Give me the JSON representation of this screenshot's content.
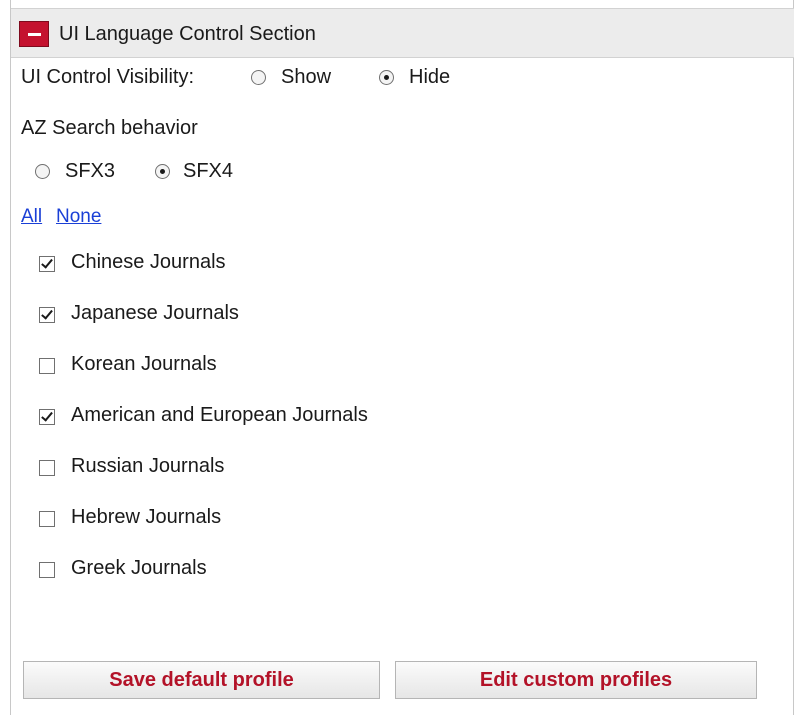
{
  "section": {
    "title": "UI Language Control Section",
    "collapse_icon": "minus-icon"
  },
  "visibility": {
    "label": "UI Control Visibility:",
    "options": [
      {
        "label": "Show",
        "checked": false
      },
      {
        "label": "Hide",
        "checked": true
      }
    ]
  },
  "az_search": {
    "label": "AZ Search behavior",
    "options": [
      {
        "label": "SFX3",
        "checked": false
      },
      {
        "label": "SFX4",
        "checked": true
      }
    ]
  },
  "select_links": {
    "all": "All",
    "none": "None"
  },
  "journals": [
    {
      "label": "Chinese Journals",
      "checked": true
    },
    {
      "label": "Japanese Journals",
      "checked": true
    },
    {
      "label": "Korean Journals",
      "checked": false
    },
    {
      "label": "American and European Journals",
      "checked": true
    },
    {
      "label": "Russian Journals",
      "checked": false
    },
    {
      "label": "Hebrew Journals",
      "checked": false
    },
    {
      "label": "Greek Journals",
      "checked": false
    }
  ],
  "buttons": {
    "save": "Save default profile",
    "edit": "Edit custom profiles"
  },
  "colors": {
    "accent_red": "#c4122f",
    "button_text": "#b31228",
    "link": "#1a3fd6",
    "header_bg": "#ececec"
  }
}
